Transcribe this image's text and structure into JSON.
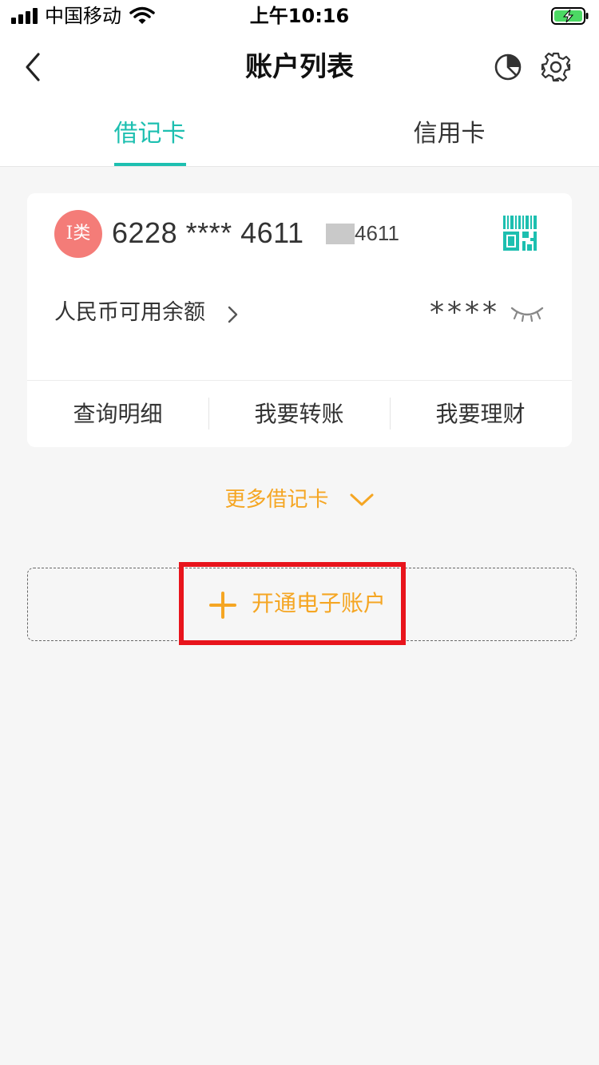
{
  "status_bar": {
    "carrier": "中国移动",
    "time": "上午10:16"
  },
  "header": {
    "title": "账户列表",
    "back_icon": "chevron-left-icon",
    "chart_icon": "pie-chart-icon",
    "settings_icon": "gear-icon"
  },
  "tabs": [
    {
      "label": "借记卡",
      "active": true
    },
    {
      "label": "信用卡",
      "active": false
    }
  ],
  "card": {
    "type_badge": "I类",
    "number": "6228 **** 4611",
    "suffix": "4611",
    "qr_icon": "qr-barcode-icon",
    "balance_label": "人民币可用余额",
    "balance_mask": "****",
    "eye_icon": "eye-closed-icon",
    "actions": [
      "查询明细",
      "我要转账",
      "我要理财"
    ]
  },
  "more": {
    "label": "更多借记卡"
  },
  "open_account": {
    "label": "开通电子账户"
  },
  "colors": {
    "accent": "#1dbfb0",
    "orange": "#f5a623",
    "badge": "#f47c78",
    "highlight": "#e8141c"
  }
}
